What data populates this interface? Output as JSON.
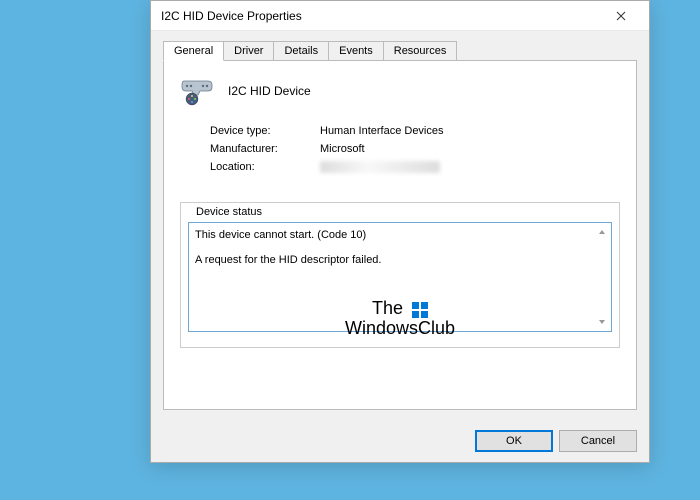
{
  "dialog": {
    "title": "I2C HID Device Properties"
  },
  "tabs": {
    "general": "General",
    "driver": "Driver",
    "details": "Details",
    "events": "Events",
    "resources": "Resources"
  },
  "device": {
    "name": "I2C HID Device",
    "type_label": "Device type:",
    "type_value": "Human Interface Devices",
    "manufacturer_label": "Manufacturer:",
    "manufacturer_value": "Microsoft",
    "location_label": "Location:"
  },
  "status": {
    "legend": "Device status",
    "line1": "This device cannot start. (Code 10)",
    "line2": "A request for the HID descriptor failed."
  },
  "buttons": {
    "ok": "OK",
    "cancel": "Cancel"
  },
  "watermark": {
    "line1": "The",
    "line2": "WindowsClub"
  }
}
